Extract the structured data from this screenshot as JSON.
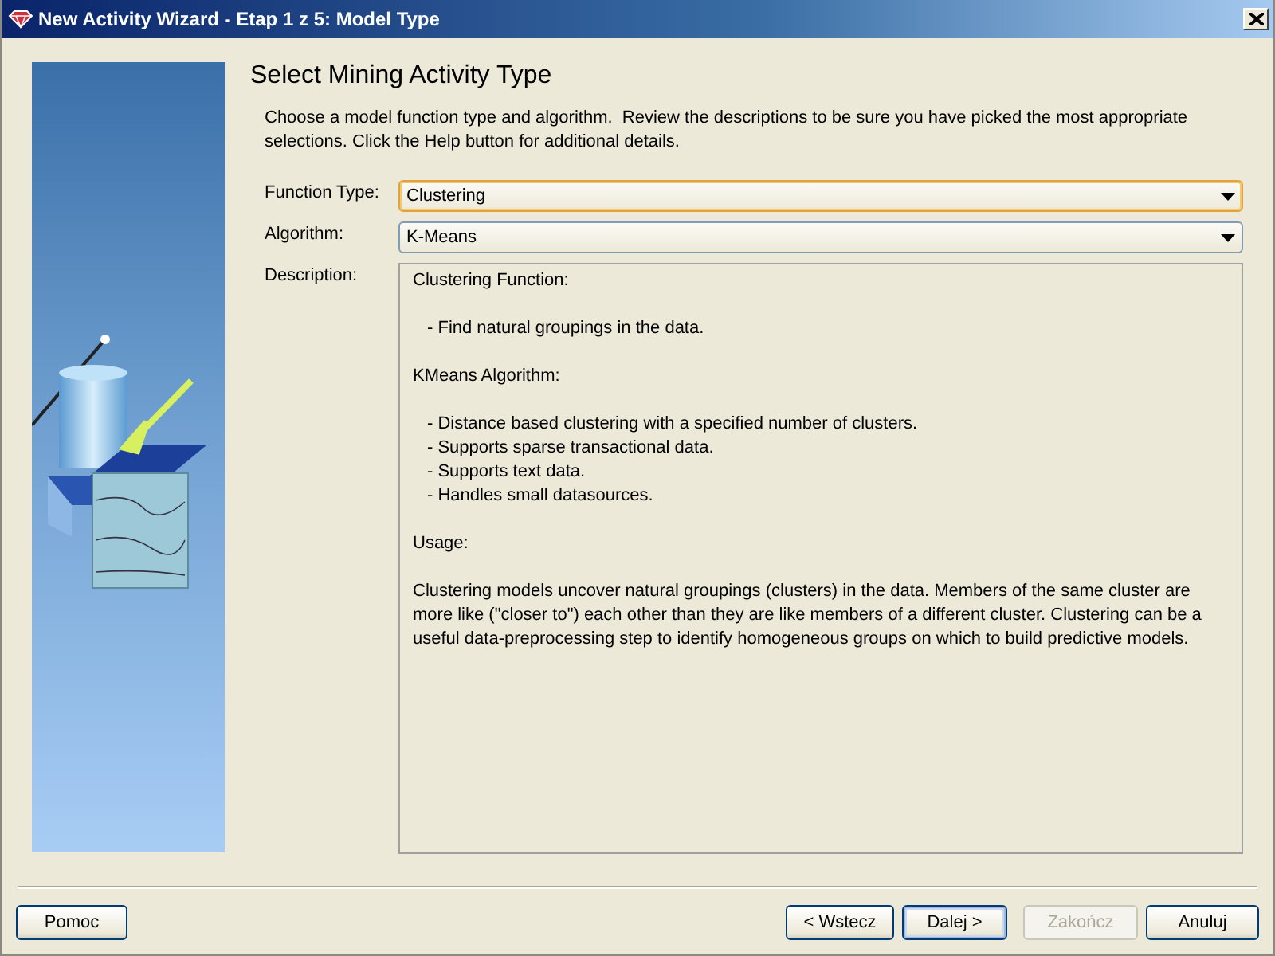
{
  "window": {
    "title": "New Activity Wizard - Etap 1 z 5: Model Type"
  },
  "heading": "Select Mining Activity Type",
  "intro": "Choose a model function type and algorithm.  Review the descriptions to be sure you have picked the most appropriate selections. Click the Help button for additional details.",
  "fields": [
    {
      "label": "Function Type:",
      "value": "Clustering",
      "focused": true
    },
    {
      "label": "Algorithm:",
      "value": "K-Means",
      "focused": false
    }
  ],
  "description": {
    "label": "Description:",
    "sections": [
      {
        "kind": "list",
        "heading": "Clustering Function:",
        "lines": [
          "- Find natural groupings in the data."
        ]
      },
      {
        "kind": "list",
        "heading": "KMeans Algorithm:",
        "lines": [
          "- Distance based clustering with a specified number of clusters.",
          "- Supports sparse transactional data.",
          "- Supports text data.",
          "- Handles small datasources."
        ]
      },
      {
        "kind": "text",
        "heading": "Usage:",
        "lines": [
          "Clustering models uncover natural groupings (clusters) in the data. Members of the same cluster are more like (\"closer to\") each other than they are like members of a different cluster. Clustering can be a useful data-preprocessing step to identify homogeneous groups on which to build predictive models."
        ]
      }
    ]
  },
  "help_button": {
    "label": "Pomoc",
    "disabled": false,
    "default": false
  },
  "buttons": [
    {
      "label": "< Wstecz",
      "disabled": false,
      "default": false
    },
    {
      "label": "Dalej >",
      "disabled": false,
      "default": true
    },
    {
      "label": "Zakończ",
      "disabled": true,
      "default": false
    },
    {
      "label": "Anuluj",
      "disabled": false,
      "default": false
    }
  ]
}
